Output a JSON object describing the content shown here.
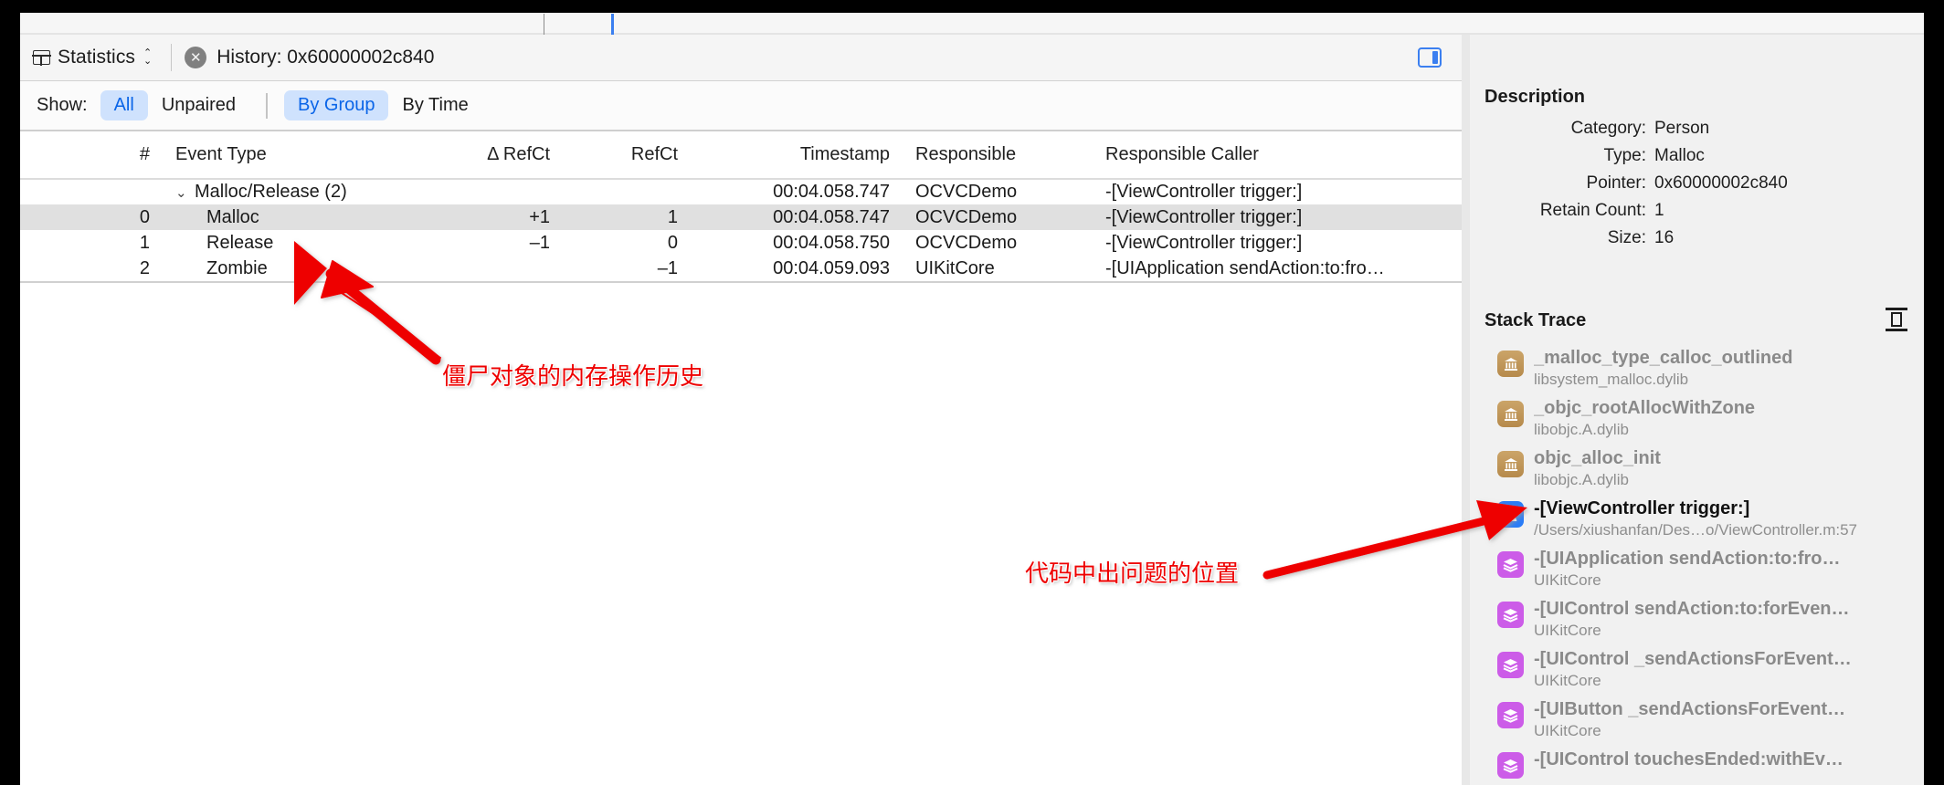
{
  "toolbar": {
    "statistics_label": "Statistics",
    "grid_icon": "grid-icon",
    "chevron_up": "⌃",
    "chevron_down": "⌄",
    "close_glyph": "✕",
    "history_label": "History: 0x60000002c840",
    "panel_toggle_icon": "right-panel-toggle-icon"
  },
  "filterbar": {
    "show_label": "Show:",
    "options": [
      {
        "label": "All",
        "active": true
      },
      {
        "label": "Unpaired",
        "active": false
      }
    ],
    "grouping": [
      {
        "label": "By Group",
        "active": true
      },
      {
        "label": "By Time",
        "active": false
      }
    ]
  },
  "table": {
    "columns": [
      "#",
      "Event Type",
      "Δ RefCt",
      "RefCt",
      "Timestamp",
      "Responsible",
      "Responsible Caller"
    ],
    "rows": [
      {
        "num": "",
        "event": "Malloc/Release (2)",
        "drefct": "",
        "refct": "",
        "timestamp": "00:04.058.747",
        "responsible": "OCVCDemo",
        "caller": "-[ViewController trigger:]",
        "group": true,
        "selected": false,
        "disclosure": "⌄"
      },
      {
        "num": "0",
        "event": "Malloc",
        "drefct": "+1",
        "refct": "1",
        "timestamp": "00:04.058.747",
        "responsible": "OCVCDemo",
        "caller": "-[ViewController trigger:]",
        "group": false,
        "selected": true,
        "disclosure": ""
      },
      {
        "num": "1",
        "event": "Release",
        "drefct": "–1",
        "refct": "0",
        "timestamp": "00:04.058.750",
        "responsible": "OCVCDemo",
        "caller": "-[ViewController trigger:]",
        "group": false,
        "selected": false,
        "disclosure": ""
      },
      {
        "num": "2",
        "event": "Zombie",
        "drefct": "",
        "refct": "–1",
        "timestamp": "00:04.059.093",
        "responsible": "UIKitCore",
        "caller": "-[UIApplication sendAction:to:fro…",
        "group": false,
        "selected": false,
        "disclosure": ""
      }
    ]
  },
  "description": {
    "title": "Description",
    "rows": [
      {
        "key": "Category:",
        "value": "Person"
      },
      {
        "key": "Type:",
        "value": "Malloc"
      },
      {
        "key": "Pointer:",
        "value": "0x60000002c840"
      },
      {
        "key": "Retain Count:",
        "value": "1"
      },
      {
        "key": "Size:",
        "value": "16"
      }
    ]
  },
  "stack_trace": {
    "title": "Stack Trace",
    "action_icon": "align-frames-icon",
    "frames": [
      {
        "name": "_malloc_type_calloc_outlined",
        "sub": "libsystem_malloc.dylib",
        "icon": "system-library-icon",
        "kind": "system",
        "glyph": "🏛",
        "emph": false
      },
      {
        "name": "_objc_rootAllocWithZone",
        "sub": "libobjc.A.dylib",
        "icon": "system-library-icon",
        "kind": "system",
        "glyph": "🏛",
        "emph": false
      },
      {
        "name": "objc_alloc_init",
        "sub": "libobjc.A.dylib",
        "icon": "system-library-icon",
        "kind": "system",
        "glyph": "🏛",
        "emph": false
      },
      {
        "name": "-[ViewController trigger:]",
        "sub": "/Users/xiushanfan/Des…o/ViewController.m:57",
        "icon": "user-code-icon",
        "kind": "user",
        "glyph": "👤",
        "emph": true
      },
      {
        "name": "-[UIApplication sendAction:to:fro…",
        "sub": "UIKitCore",
        "icon": "framework-icon",
        "kind": "framework",
        "glyph": "☲",
        "emph": false
      },
      {
        "name": "-[UIControl sendAction:to:forEven…",
        "sub": "UIKitCore",
        "icon": "framework-icon",
        "kind": "framework",
        "glyph": "☲",
        "emph": false
      },
      {
        "name": "-[UIControl _sendActionsForEvent…",
        "sub": "UIKitCore",
        "icon": "framework-icon",
        "kind": "framework",
        "glyph": "☲",
        "emph": false
      },
      {
        "name": "-[UIButton _sendActionsForEvent…",
        "sub": "UIKitCore",
        "icon": "framework-icon",
        "kind": "framework",
        "glyph": "☲",
        "emph": false
      },
      {
        "name": "-[UIControl touchesEnded:withEv…",
        "sub": "",
        "icon": "framework-icon",
        "kind": "framework",
        "glyph": "☲",
        "emph": false
      }
    ]
  },
  "annotations": [
    {
      "text": "僵尸对象的内存操作历史",
      "color": "#ee0000"
    },
    {
      "text": "代码中出问题的位置",
      "color": "#ee0000"
    }
  ],
  "colors": {
    "accent": "#3b7ff0",
    "segment_active_bg": "#cfe2fd",
    "segment_active_fg": "#0a65e8",
    "annotation_red": "#ee0000",
    "row_selected_bg": "#e0e0e0",
    "panel_bg": "#f1f1f1"
  }
}
